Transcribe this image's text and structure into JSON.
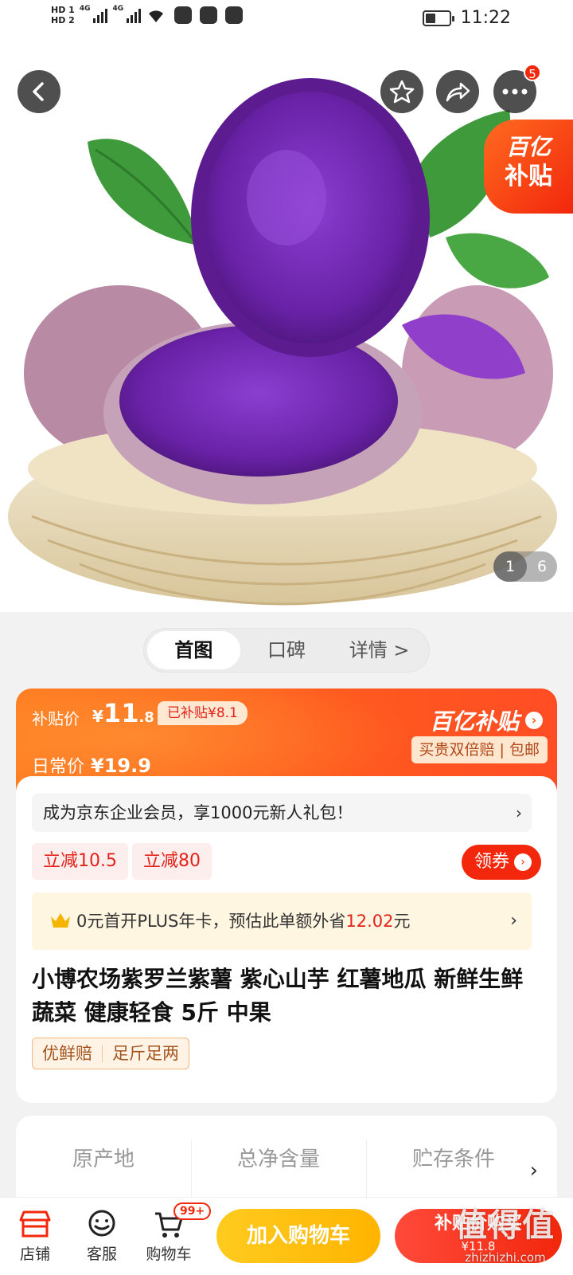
{
  "status_bar": {
    "time": "11:22",
    "sim1": "HD 1",
    "sim2": "HD 2",
    "network1": "4G",
    "network2": "4G"
  },
  "header": {
    "badge_count": "5",
    "subsidy_flag": {
      "line1": "百亿",
      "line2": "补贴"
    }
  },
  "gallery": {
    "current": "1",
    "total": "6"
  },
  "tabs": [
    {
      "label": "首图",
      "active": true
    },
    {
      "label": "口碑"
    },
    {
      "label": "详情 >"
    }
  ],
  "price": {
    "subsidy_label": "补贴价",
    "currency": "¥",
    "subsidy_int": "11",
    "subsidy_dec": ".8",
    "saved_tag": "已补贴¥8.1",
    "daily_label": "日常价",
    "daily_price": "¥19.9",
    "brand_logo": "百亿补贴",
    "guarantee": "买贵双倍赔 | 包邮"
  },
  "member_bar": {
    "text": "成为京东企业会员，享1000元新人礼包！",
    "chevron": "›"
  },
  "coupons": [
    "立减10.5",
    "立减80"
  ],
  "get_coupon": "领券",
  "plus_bar": {
    "text_a": "0元首开PLUS年卡，预估此单额外省",
    "amount": "12.02",
    "unit": "元",
    "chevron": "›"
  },
  "product_title": "小博农场紫罗兰紫薯 紫心山芋  红薯地瓜 新鲜生鲜蔬菜 健康轻食 5斤 中果",
  "tags": [
    "优鲜赔",
    "足斤足两"
  ],
  "specs": [
    "原产地",
    "总净含量",
    "贮存条件"
  ],
  "bottom_nav": [
    {
      "label": "店铺",
      "icon": "store-icon"
    },
    {
      "label": "客服",
      "icon": "chat-smile-icon"
    },
    {
      "label": "购物车",
      "icon": "cart-icon",
      "badge": "99+"
    }
  ],
  "buttons": {
    "add_cart": "加入购物车",
    "buy_subsidy": "补贴价购买",
    "buy_price": "¥11.8"
  },
  "watermark": {
    "main": "值得值",
    "sub": "zhizhizhi.com"
  },
  "colors": {
    "accent": "#f2270c",
    "orange": "#ff5a1f",
    "yellow": "#ffb400"
  }
}
